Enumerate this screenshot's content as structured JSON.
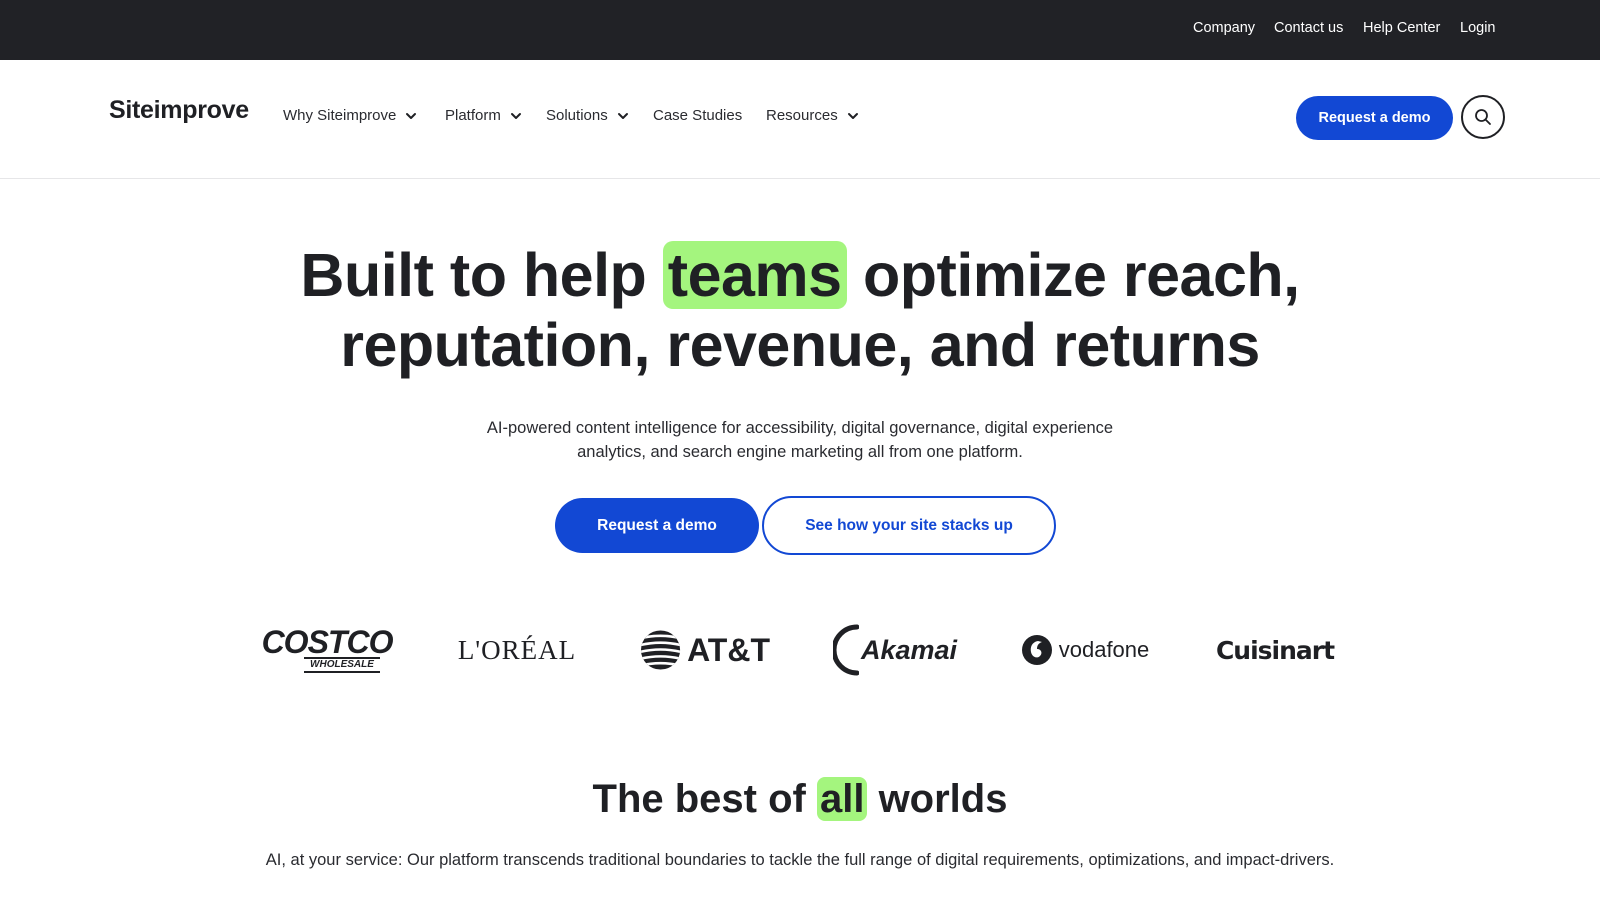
{
  "topbar": {
    "links": [
      "Company",
      "Contact us",
      "Help Center",
      "Login"
    ]
  },
  "nav": {
    "brand": "Siteimprove",
    "items": [
      {
        "label": "Why Siteimprove",
        "dropdown": true
      },
      {
        "label": "Platform",
        "dropdown": true
      },
      {
        "label": "Solutions",
        "dropdown": true
      },
      {
        "label": "Case Studies",
        "dropdown": false
      },
      {
        "label": "Resources",
        "dropdown": true
      }
    ],
    "demo_label": "Request a demo",
    "search_icon": "search-icon"
  },
  "hero": {
    "title_before": "Built to help ",
    "title_highlight": "teams",
    "title_after": " optimize reach,",
    "title_line2": "reputation, revenue, and returns",
    "subtitle": "AI-powered content intelligence for accessibility, digital governance, digital experience analytics, and search engine marketing all from one platform.",
    "primary_cta": "Request a demo",
    "secondary_cta": "See how your site stacks up"
  },
  "logos": {
    "costco_top": "COSTCO",
    "costco_bottom": "WHOLESALE",
    "loreal": "L'ORÉAL",
    "att": "AT&T",
    "akamai": "Akamai",
    "vodafone": "vodafone",
    "cuisinart": "Cuisinart"
  },
  "section2": {
    "title_before": "The best of ",
    "title_highlight": "all",
    "title_after": " worlds",
    "subtitle": "AI, at your service: Our platform transcends traditional boundaries to tackle the full range of digital requirements, optimizations, and impact-drivers."
  },
  "colors": {
    "topbar_bg": "#212226",
    "primary_blue": "#1248d4",
    "highlight_green": "#a4f57e",
    "text_dark": "#1f2024"
  }
}
